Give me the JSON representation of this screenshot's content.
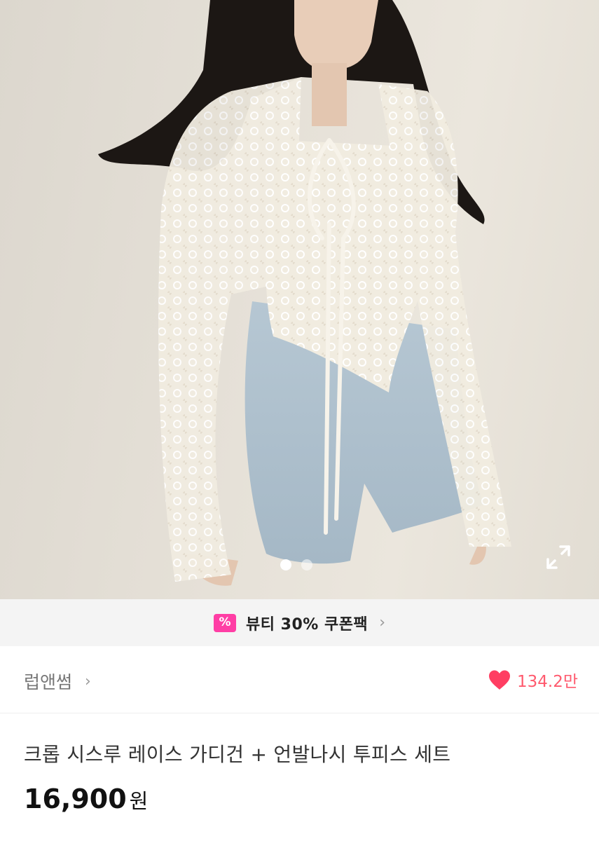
{
  "gallery": {
    "total_images": 2,
    "current_index": 1,
    "expand_icon": "expand-icon"
  },
  "coupon": {
    "icon": "coupon-percent-icon",
    "icon_glyph": "%",
    "text": "뷰티 30% 쿠폰팩",
    "chevron": "›",
    "accent": "#ff3ea5"
  },
  "seller": {
    "name": "럽앤썸",
    "chevron": "›",
    "likes": "134.2만",
    "like_icon": "heart-icon",
    "like_color": "#ff3e62"
  },
  "product": {
    "title": "크롭 시스루 레이스 가디건 + 언발나시 투피스 세트",
    "price": "16,900",
    "currency": "원"
  }
}
